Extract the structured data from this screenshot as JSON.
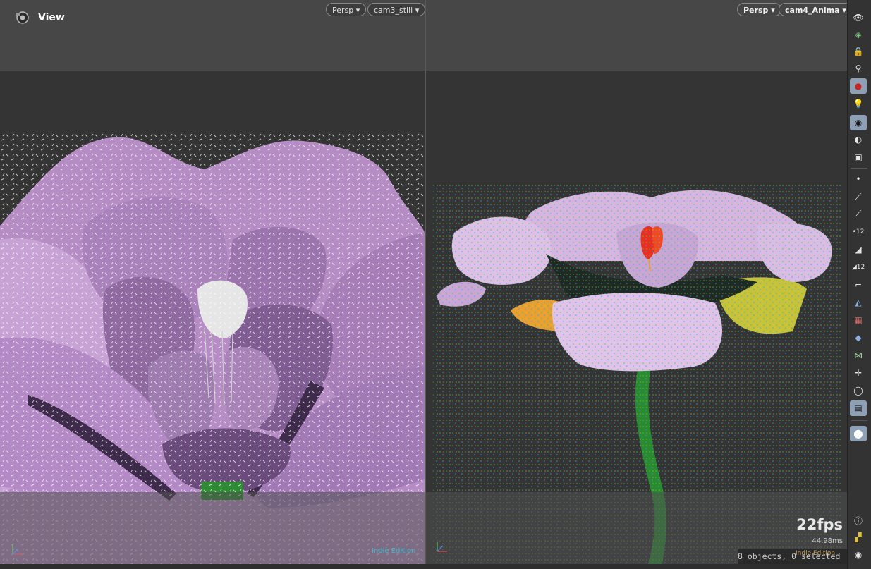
{
  "left_view": {
    "title": "View",
    "projection": "Persp",
    "camera": "cam3_still",
    "watermark": "Indie Edition"
  },
  "right_view": {
    "projection": "Persp",
    "camera": "cam4_Anima",
    "fps": "22fps",
    "frame_time": "44.98ms",
    "selection_status": "8 objects, 0 selected",
    "watermark": "Indie Edition"
  },
  "toolbar": {
    "icons": [
      "display-options-icon",
      "ghost-icon",
      "lock-icon",
      "light-bulb-icon",
      "shading-icon",
      "headlight-icon",
      "camera-icon",
      "visualize-icon",
      "flipbook-icon",
      "point-icon",
      "normal-icon",
      "vertex-normal-icon",
      "point-number-icon",
      "primitive-icon",
      "prim-number-icon",
      "uv-border-icon",
      "backface-icon",
      "texture-icon",
      "geometry-icon",
      "symmetry-icon",
      "origin-icon",
      "safe-area-icon",
      "background-icon",
      "pin-icon",
      "info-icon",
      "layout-icon",
      "eye-icon"
    ],
    "active": [
      "shading-icon",
      "camera-icon",
      "background-icon",
      "pin-icon"
    ]
  },
  "colors": {
    "petal_light": "#e0c0e8",
    "petal_mid": "#b88ac8",
    "petal_dark": "#5c3d6e",
    "stem": "#2a8a30",
    "stamen_red": "#e83020",
    "active_tool": "#8ea0b5"
  }
}
